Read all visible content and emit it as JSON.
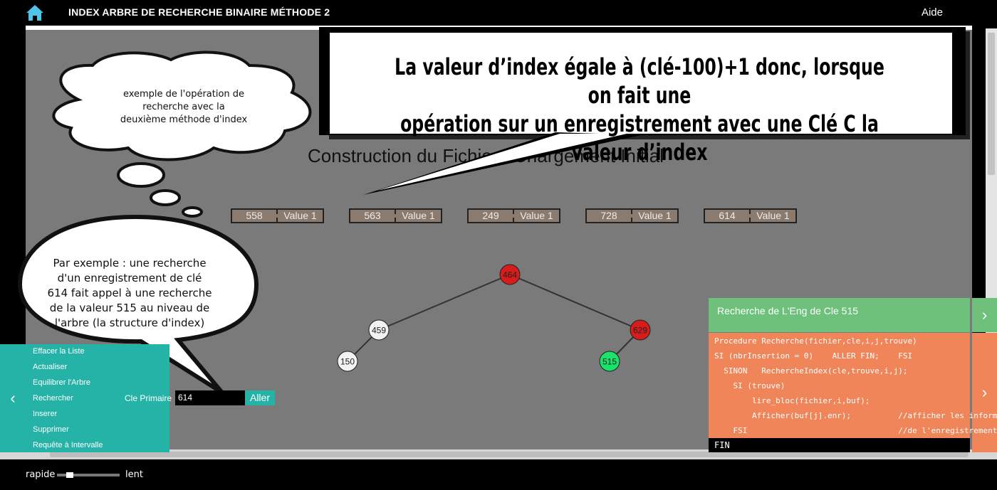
{
  "header": {
    "title": "INDEX ARBRE DE RECHERCHE BINAIRE   MÉTHODE 2",
    "help": "Aide"
  },
  "icons": {
    "home": "home-icon",
    "left_chevron": "chevron-left-icon",
    "right_chevron": "chevron-right-icon"
  },
  "canvas": {
    "section_title": "Construction du Fichier : Chargement Initial"
  },
  "records": [
    {
      "key": "558",
      "value": "Value 1"
    },
    {
      "key": "563",
      "value": "Value 1"
    },
    {
      "key": "249",
      "value": "Value 1"
    },
    {
      "key": "728",
      "value": "Value 1"
    },
    {
      "key": "614",
      "value": "Value 1"
    }
  ],
  "tree": {
    "nodes": [
      {
        "label": "464",
        "color": "#d81c1c"
      },
      {
        "label": "459",
        "color": "#f2f2f2"
      },
      {
        "label": "629",
        "color": "#d81c1c"
      },
      {
        "label": "150",
        "color": "#f2f2f2"
      },
      {
        "label": "515",
        "color": "#19e36a"
      }
    ],
    "edges": [
      [
        "464",
        "459"
      ],
      [
        "464",
        "629"
      ],
      [
        "459",
        "150"
      ],
      [
        "629",
        "515"
      ]
    ]
  },
  "annotations": {
    "thought_bubble_lines": [
      "exemple de l'opération de",
      "recherche avec la",
      "deuxième méthode d'index"
    ],
    "callout_lines": [
      "La valeur d’index égale à (clé-100)+1 donc, lorsque on fait une",
      "opération sur un enregistrement avec une Clé C la valeur d’index"
    ],
    "speech_bubble_lines": [
      "Par exemple : une recherche",
      "d'un enregistrement de clé",
      "614 fait appel à une recherche",
      "de la valeur 515 au niveau de",
      "l'arbre (la structure d'index)"
    ]
  },
  "left_panel": {
    "items": [
      "Effacer la Liste",
      "Actualiser",
      "Equilibrer l'Arbre",
      "Rechercher",
      "Inserer",
      "Supprimer",
      "Requête à Intervalle"
    ],
    "key_label": "Cle Primaire",
    "key_value": "614",
    "go_label": "Aller"
  },
  "algo_panel": {
    "title": "Recherche de L'Eng de Cle 515",
    "code_lines": [
      "Procedure Recherche(fichier,cle,i,j,trouve)",
      "SI (nbrInsertion = 0)    ALLER FIN;    FSI",
      "  SINON   RechercheIndex(cle,trouve,i,j);",
      "    SI (trouve)",
      "        lire_bloc(fichier,i,buf);",
      "        Afficher(buf[j].enr);          //afficher les informations",
      "    FSI                                //de l'enregistrement"
    ],
    "footer": "FIN"
  },
  "speed": {
    "fast": "rapide",
    "slow": "lent",
    "level": 0.15
  },
  "colors": {
    "teal": "#26b3a7",
    "green": "#6dc17b",
    "orange": "#f0855a",
    "canvas": "#7a7a7a"
  }
}
